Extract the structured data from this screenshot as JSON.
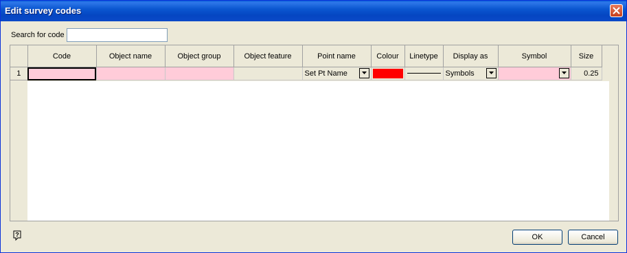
{
  "window": {
    "title": "Edit survey codes"
  },
  "search": {
    "label": "Search for code",
    "value": ""
  },
  "table": {
    "columns": [
      "Code",
      "Object name",
      "Object group",
      "Object feature",
      "Point name",
      "Colour",
      "Linetype",
      "Display as",
      "Symbol",
      "Size"
    ],
    "rows": [
      {
        "num": "1",
        "code": "",
        "object_name": "",
        "object_group": "",
        "object_feature": "",
        "point_name": "Set Pt Name",
        "colour": "#ff0000",
        "linetype": "solid",
        "display_as": "Symbols",
        "symbol": "",
        "size": "0.25"
      }
    ]
  },
  "buttons": {
    "ok": "OK",
    "cancel": "Cancel"
  },
  "icons": {
    "help": "help-question-icon",
    "close": "close-icon",
    "dropdown": "chevron-down-icon"
  }
}
